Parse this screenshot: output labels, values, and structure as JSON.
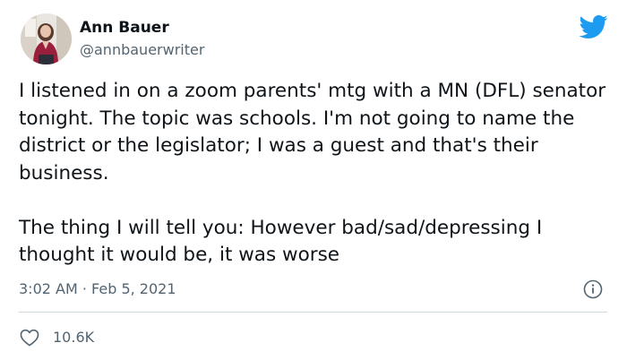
{
  "author": {
    "name": "Ann Bauer",
    "handle": "@annbauerwriter",
    "avatar_icon": "user-avatar-photo"
  },
  "brand": {
    "logo_icon": "twitter-bird-icon",
    "accent_color": "#1d9bf0"
  },
  "tweet": {
    "paragraphs": [
      "I listened in on a zoom parents' mtg with a MN (DFL) senator tonight. The topic was schools. I'm not going to name the district or the legislator; I was a guest and that's their business.",
      "The thing I will tell you: However bad/sad/depressing I thought it would be, it was worse"
    ],
    "timestamp": "3:02 AM · Feb 5, 2021"
  },
  "engagement": {
    "like_icon": "heart-icon",
    "likes": "10.6K",
    "info_icon": "info-icon"
  }
}
